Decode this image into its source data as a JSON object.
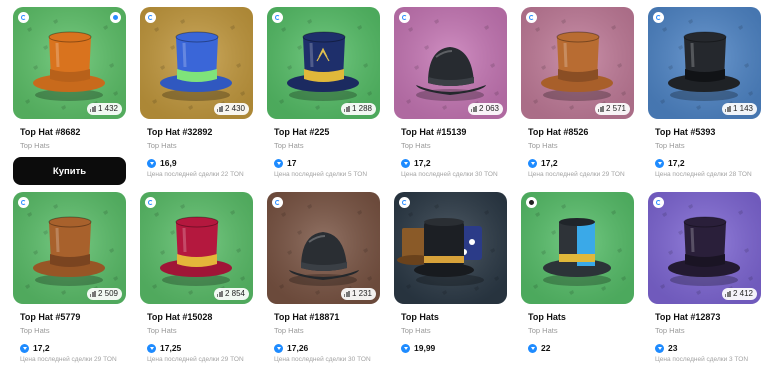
{
  "buy_label": "Купить",
  "cards": [
    {
      "title": "Top Hat #8682",
      "collection": "Top Hats",
      "supply": "1 432",
      "price": "",
      "last_sale": "",
      "has_buy": true,
      "bg": "#5ec36a",
      "hat_body": "#d9731e",
      "hat_band": "#b8611a",
      "hat_brim": "#c86a1c",
      "badge": "blue",
      "top_right_badge": true
    },
    {
      "title": "Top Hat #32892",
      "collection": "Top Hats",
      "supply": "2 430",
      "price": "16,9",
      "last_sale": "Цена последней сделки 22 TON",
      "has_buy": false,
      "bg": "#c49a3e",
      "hat_body": "#3a66d8",
      "hat_band": "#7fe37a",
      "hat_brim": "#3058c0",
      "badge": "blue",
      "top_right_badge": false
    },
    {
      "title": "Top Hat #225",
      "collection": "Top Hats",
      "supply": "1 288",
      "price": "17",
      "last_sale": "Цена последней сделки 5 TON",
      "has_buy": false,
      "bg": "#56c068",
      "hat_body": "#1e2f6b",
      "hat_band": "#e0b83a",
      "hat_brim": "#1b2a60",
      "badge": "blue",
      "top_right_badge": false
    },
    {
      "title": "Top Hat #15139",
      "collection": "Top Hats",
      "supply": "2 063",
      "price": "17,2",
      "last_sale": "Цена последней сделки 30 TON",
      "has_buy": false,
      "bg": "#c777b6",
      "hat_body": "#272b30",
      "hat_band": "#3b4046",
      "hat_brim": "#23272c",
      "badge": "blue",
      "top_right_badge": false,
      "bowler": true
    },
    {
      "title": "Top Hat #8526",
      "collection": "Top Hats",
      "supply": "2 571",
      "price": "17,2",
      "last_sale": "Цена последней сделки 29 TON",
      "has_buy": false,
      "bg": "#c27c9a",
      "hat_body": "#b86c32",
      "hat_band": "#8a4e24",
      "hat_brim": "#a85f2a",
      "badge": "blue",
      "top_right_badge": false
    },
    {
      "title": "Top Hat #5393",
      "collection": "Top Hats",
      "supply": "1 143",
      "price": "17,2",
      "last_sale": "Цена последней сделки 28 TON",
      "has_buy": false,
      "bg": "#4f86c8",
      "hat_body": "#25282d",
      "hat_band": "#111316",
      "hat_brim": "#1f2226",
      "badge": "blue",
      "top_right_badge": false
    },
    {
      "title": "Top Hat #5779",
      "collection": "Top Hats",
      "supply": "2 509",
      "price": "17,2",
      "last_sale": "Цена последней сделки 29 TON",
      "has_buy": false,
      "bg": "#5bc06a",
      "hat_body": "#a8612c",
      "hat_band": "#7a4420",
      "hat_brim": "#975626",
      "badge": "blue",
      "top_right_badge": false
    },
    {
      "title": "Top Hat #15028",
      "collection": "Top Hats",
      "supply": "2 854",
      "price": "17,25",
      "last_sale": "Цена последней сделки 29 TON",
      "has_buy": false,
      "bg": "#5bc06a",
      "hat_body": "#b4183e",
      "hat_band": "#e4b63a",
      "hat_brim": "#a01537",
      "badge": "blue",
      "top_right_badge": false
    },
    {
      "title": "Top Hat #18871",
      "collection": "Top Hats",
      "supply": "1 231",
      "price": "17,26",
      "last_sale": "Цена последней сделки 30 TON",
      "has_buy": false,
      "bg": "#7a5443",
      "hat_body": "#2a2e33",
      "hat_band": "#3a3f45",
      "hat_brim": "#24282c",
      "badge": "blue",
      "top_right_badge": false,
      "bowler": true
    },
    {
      "title": "Top Hats",
      "collection": "Top Hats",
      "supply": "",
      "price": "19,99",
      "last_sale": "",
      "has_buy": false,
      "bg": "#2c3a47",
      "hat_body": "#1c1f24",
      "hat_band": "#d7a23a",
      "hat_brim": "#181b1f",
      "badge": "blue",
      "top_right_badge": false,
      "multi": true
    },
    {
      "title": "Top Hats",
      "collection": "Top Hats",
      "supply": "",
      "price": "22",
      "last_sale": "",
      "has_buy": false,
      "bg": "#57c06a",
      "hat_body": "#3aa9e8",
      "hat_band": "#e0b83a",
      "hat_brim": "#2f8fd0",
      "badge": "dark",
      "top_right_badge": false,
      "split": true
    },
    {
      "title": "Top Hat #12873",
      "collection": "Top Hats",
      "supply": "2 412",
      "price": "23",
      "last_sale": "Цена последней сделки 3 TON",
      "has_buy": false,
      "bg": "#7f67d6",
      "hat_body": "#2a1f3a",
      "hat_band": "#1a1424",
      "hat_brim": "#231a31",
      "badge": "blue",
      "top_right_badge": false
    }
  ]
}
